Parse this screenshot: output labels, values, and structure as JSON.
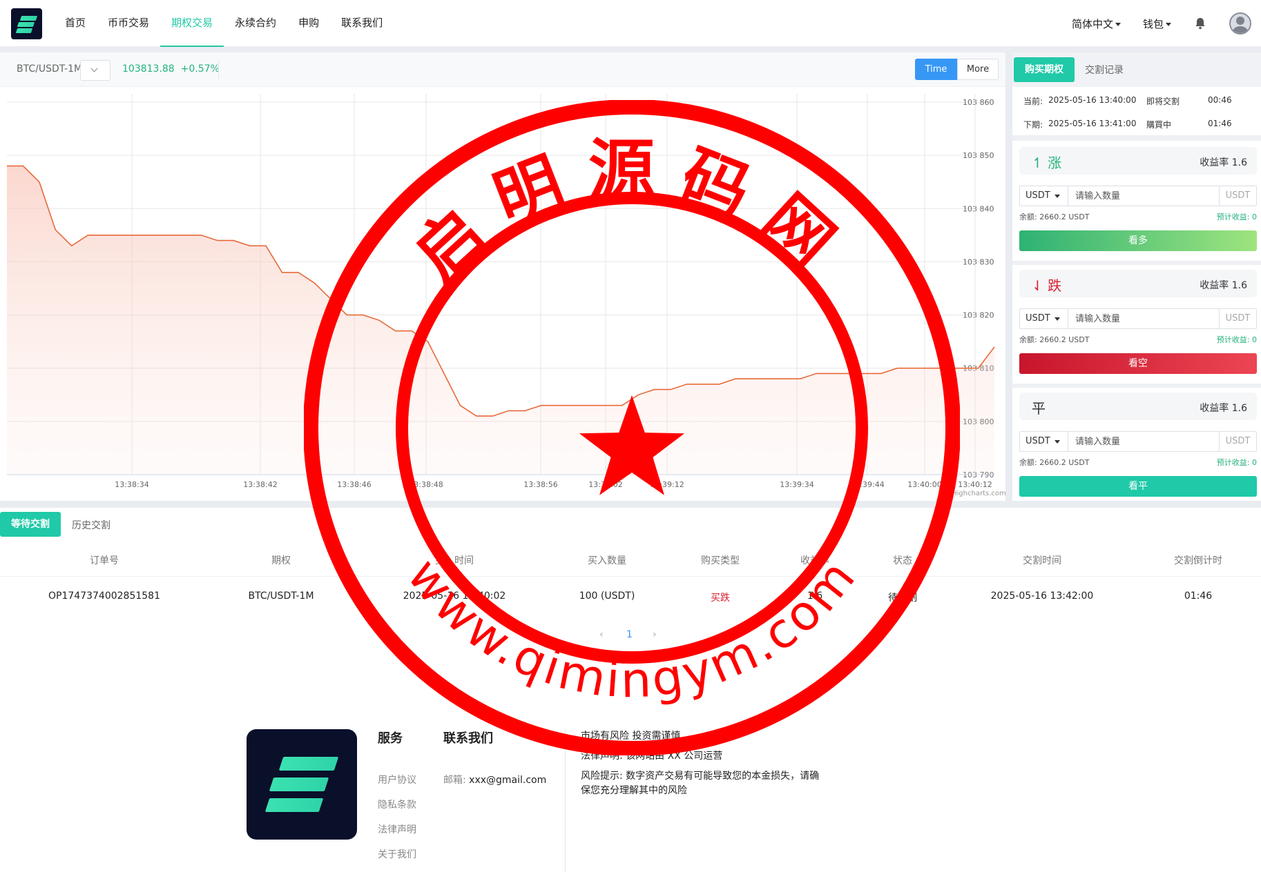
{
  "nav": {
    "items": [
      "首页",
      "币币交易",
      "期权交易",
      "永续合约",
      "申购",
      "联系我们"
    ],
    "active": "期权交易",
    "language": "简体中文",
    "wallet": "钱包"
  },
  "ticker": {
    "pair": "BTC/USDT-1M",
    "price": "103813.88",
    "change": "+0.57%",
    "time_btn": "Time",
    "more_btn": "More",
    "credit": "Highcharts.com"
  },
  "chart_data": {
    "type": "area",
    "series": [
      {
        "color": "#e8693a",
        "values": [
          103848,
          103848,
          103845,
          103836,
          103833,
          103835,
          103835,
          103835,
          103835,
          103835,
          103835,
          103835,
          103835,
          103834,
          103834,
          103833,
          103833,
          103828,
          103828,
          103826,
          103823,
          103820,
          103820,
          103819,
          103817,
          103817,
          103815,
          103809,
          103803,
          103801,
          103801,
          103802,
          103802,
          103803,
          103803,
          103803,
          103803,
          103803,
          103803,
          103805,
          103806,
          103806,
          103807,
          103807,
          103807,
          103808,
          103808,
          103808,
          103808,
          103808,
          103809,
          103809,
          103809,
          103809,
          103809,
          103810,
          103810,
          103810,
          103810,
          103810,
          103810,
          103814
        ]
      }
    ],
    "x_ticks": [
      "13:38:34",
      "13:38:42",
      "13:38:46",
      "13:38:48",
      "13:38:56",
      "13:39:02",
      "13:39:12",
      "13:39:34",
      "13:39:44",
      "13:40:00",
      "13:40:12"
    ],
    "y_ticks": [
      "103 860",
      "103 850",
      "103 840",
      "103 830",
      "103 820",
      "103 810",
      "103 800",
      "103 790"
    ],
    "ylim": [
      103790,
      103860
    ],
    "grid": true,
    "fill": "gradient"
  },
  "panel": {
    "tab_buy": "购买期权",
    "tab_records": "交割记录",
    "current_label": "当前:",
    "current_time": "2025-05-16 13:40:00",
    "current_status": "即将交割",
    "current_countdown": "00:46",
    "next_label": "下期:",
    "next_time": "2025-05-16 13:41:00",
    "next_status": "購買中",
    "next_countdown": "01:46",
    "options": [
      {
        "title": "↿ 涨",
        "color": "#26b27d",
        "rate": "收益率 1.6",
        "btn": "看多",
        "btn_color": "linear-gradient(90deg,#2eb274,#9ee47f)"
      },
      {
        "title": "⇃ 跌",
        "color": "#d8202f",
        "rate": "收益率 1.6",
        "btn": "看空",
        "btn_color": "linear-gradient(90deg,#c8162c,#ec4553)"
      },
      {
        "title": "平",
        "color": "#333333",
        "rate": "收益率 1.6",
        "btn": "看平",
        "btn_color": "#20c9a8"
      }
    ],
    "currency": "USDT",
    "placeholder": "请输入数量",
    "unit": "USDT",
    "balance": "余额: 2660.2 USDT",
    "estimate": "预计收益: 0"
  },
  "orders": {
    "tab_waiting": "等待交割",
    "tab_history": "历史交割",
    "headers": [
      "订单号",
      "期权",
      "买入时间",
      "买入数量",
      "购买类型",
      "收益率",
      "状态",
      "交割时间",
      "交割倒计时"
    ],
    "row": [
      "OP1747374002851581",
      "BTC/USDT-1M",
      "2025-05-16 13:40:02",
      "100 (USDT)",
      "买跌",
      "1.6",
      "待交割",
      "2025-05-16 13:42:00",
      "01:46"
    ],
    "page": "1"
  },
  "footer": {
    "service_title": "服务",
    "contact_title": "联系我们",
    "links": [
      "用户协议",
      "隐私条款",
      "法律声明",
      "关于我们"
    ],
    "email_label": "邮箱:",
    "email": "xxx@gmail.com",
    "note1": "市场有风险 投资需谨慎",
    "note2": "法律声明: 该网站由 XX 公司运营",
    "note3": "风险提示: 数字资产交易有可能导致您的本金损失，请确保您充分理解其中的风险"
  },
  "stamp": {
    "top_text": "启明源码网",
    "bottom_text": "www.qimingym.com",
    "color": "#ff0000"
  }
}
